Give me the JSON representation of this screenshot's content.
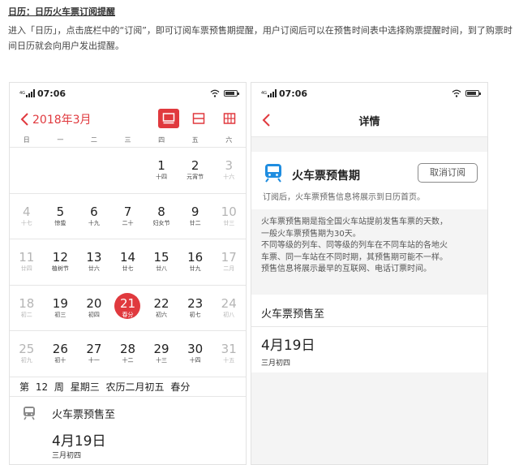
{
  "article": {
    "title": "日历：日历火车票订阅提醒",
    "body": "进入「日历」，点击底栏中的“订阅”，即可订阅车票预售期提醒，用户订阅后可以在预售时间表中选择购票提醒时间，到了购票时间日历就会向用户发出提醒。"
  },
  "left_phone": {
    "status": {
      "time": "07:06"
    },
    "month_label": "2018年3月",
    "view_buttons": [
      "single-view-icon",
      "split-view-icon",
      "grid-view-icon"
    ],
    "weekdays": [
      "日",
      "一",
      "二",
      "三",
      "四",
      "五",
      "六"
    ],
    "weeks": [
      [
        {
          "n": "",
          "l": "",
          "type": "empty"
        },
        {
          "n": "",
          "l": "",
          "type": "empty"
        },
        {
          "n": "",
          "l": "",
          "type": "empty"
        },
        {
          "n": "",
          "l": "",
          "type": "empty"
        },
        {
          "n": "1",
          "l": "十四",
          "type": "normal"
        },
        {
          "n": "2",
          "l": "元宵节",
          "type": "normal"
        },
        {
          "n": "3",
          "l": "十六",
          "type": "weekend"
        }
      ],
      [
        {
          "n": "4",
          "l": "十七",
          "type": "weekend"
        },
        {
          "n": "5",
          "l": "惊蛰",
          "type": "normal"
        },
        {
          "n": "6",
          "l": "十九",
          "type": "normal"
        },
        {
          "n": "7",
          "l": "二十",
          "type": "normal"
        },
        {
          "n": "8",
          "l": "妇女节",
          "type": "normal"
        },
        {
          "n": "9",
          "l": "廿二",
          "type": "normal"
        },
        {
          "n": "10",
          "l": "廿三",
          "type": "weekend"
        }
      ],
      [
        {
          "n": "11",
          "l": "廿四",
          "type": "weekend"
        },
        {
          "n": "12",
          "l": "植树节",
          "type": "normal"
        },
        {
          "n": "13",
          "l": "廿六",
          "type": "normal"
        },
        {
          "n": "14",
          "l": "廿七",
          "type": "normal"
        },
        {
          "n": "15",
          "l": "廿八",
          "type": "normal"
        },
        {
          "n": "16",
          "l": "廿九",
          "type": "normal"
        },
        {
          "n": "17",
          "l": "二月",
          "type": "weekend"
        }
      ],
      [
        {
          "n": "18",
          "l": "初二",
          "type": "weekend"
        },
        {
          "n": "19",
          "l": "初三",
          "type": "normal"
        },
        {
          "n": "20",
          "l": "初四",
          "type": "normal"
        },
        {
          "n": "21",
          "l": "春分",
          "type": "today"
        },
        {
          "n": "22",
          "l": "初六",
          "type": "normal"
        },
        {
          "n": "23",
          "l": "初七",
          "type": "normal"
        },
        {
          "n": "24",
          "l": "初八",
          "type": "weekend"
        }
      ],
      [
        {
          "n": "25",
          "l": "初九",
          "type": "weekend"
        },
        {
          "n": "26",
          "l": "初十",
          "type": "normal"
        },
        {
          "n": "27",
          "l": "十一",
          "type": "normal"
        },
        {
          "n": "28",
          "l": "十二",
          "type": "normal"
        },
        {
          "n": "29",
          "l": "十三",
          "type": "normal"
        },
        {
          "n": "30",
          "l": "十四",
          "type": "normal"
        },
        {
          "n": "31",
          "l": "十五",
          "type": "weekend"
        }
      ]
    ],
    "info_line": "第 12 周  星期三  农历二月初五  春分",
    "event": {
      "title": "火车票预售至",
      "date": "4月19日",
      "lunar": "三月初四"
    }
  },
  "right_phone": {
    "status": {
      "time": "07:06"
    },
    "nav_title": "详情",
    "subscription": {
      "title": "火车票预售期",
      "cancel_label": "取消订阅",
      "hint": "订阅后，火车票预售信息将展示到日历首页。"
    },
    "description": [
      "火车票预售期是指全国火车站提前发售车票的天数，",
      "一般火车票预售期为30天。",
      "不同等级的列车、同等级的列车在不同车站的各地火",
      "车票、同一车站在不同时期，其预售期可能不一样。",
      "预售信息将展示最早的互联网、电话订票时间。"
    ],
    "presale": {
      "title": "火车票预售至",
      "date": "4月19日",
      "lunar": "三月初四"
    }
  },
  "colors": {
    "accent": "#e0393e",
    "muted": "#b5b5b5",
    "icon_blue": "#1f8de0"
  }
}
